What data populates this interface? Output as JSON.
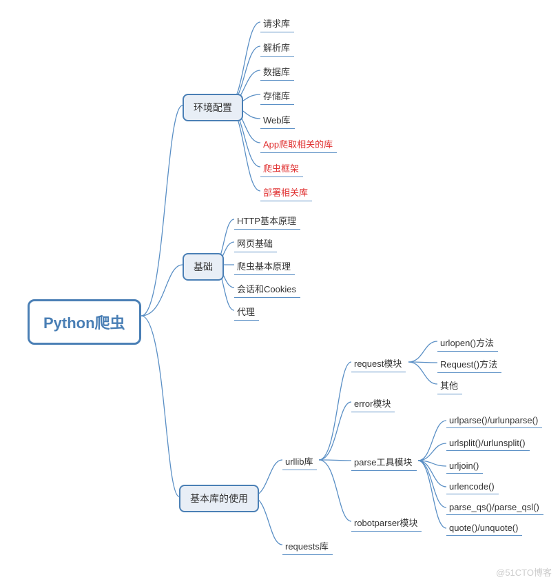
{
  "root": "Python爬虫",
  "watermark": "@51CTO博客",
  "colors": {
    "accent": "#4a7fb5",
    "line": "#5a8fc5",
    "highlight": "#e03030"
  },
  "branches": [
    {
      "label": "环境配置",
      "children": [
        {
          "label": "请求库"
        },
        {
          "label": "解析库"
        },
        {
          "label": "数据库"
        },
        {
          "label": "存储库"
        },
        {
          "label": "Web库"
        },
        {
          "label": "App爬取相关的库",
          "highlight": true
        },
        {
          "label": "爬虫框架",
          "highlight": true
        },
        {
          "label": "部署相关库",
          "highlight": true
        }
      ]
    },
    {
      "label": "基础",
      "children": [
        {
          "label": "HTTP基本原理"
        },
        {
          "label": "网页基础"
        },
        {
          "label": "爬虫基本原理"
        },
        {
          "label": "会话和Cookies"
        },
        {
          "label": "代理"
        }
      ]
    },
    {
      "label": "基本库的使用",
      "children": [
        {
          "label": "urllib库",
          "children": [
            {
              "label": "request模块",
              "children": [
                {
                  "label": "urlopen()方法"
                },
                {
                  "label": "Request()方法"
                },
                {
                  "label": "其他"
                }
              ]
            },
            {
              "label": "error模块"
            },
            {
              "label": "parse工具模块",
              "children": [
                {
                  "label": "urlparse()/urlunparse()"
                },
                {
                  "label": "urlsplit()/urlunsplit()"
                },
                {
                  "label": "urljoin()"
                },
                {
                  "label": "urlencode()"
                },
                {
                  "label": "parse_qs()/parse_qsl()"
                },
                {
                  "label": "quote()/unquote()"
                }
              ]
            },
            {
              "label": "robotparser模块"
            }
          ]
        },
        {
          "label": "requests库"
        }
      ]
    }
  ]
}
